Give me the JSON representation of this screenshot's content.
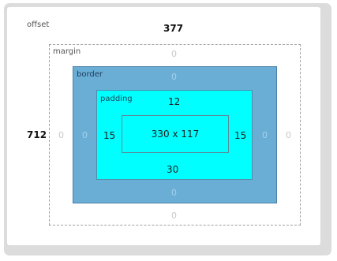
{
  "labels": {
    "offset": "offset",
    "margin": "margin",
    "border": "border",
    "padding": "padding"
  },
  "offset": {
    "top": "377",
    "left": "712"
  },
  "margin": {
    "top": "0",
    "right": "0",
    "bottom": "0",
    "left": "0"
  },
  "border": {
    "top": "0",
    "right": "0",
    "bottom": "0",
    "left": "0"
  },
  "padding": {
    "top": "12",
    "right": "15",
    "bottom": "30",
    "left": "15"
  },
  "content": {
    "size": "330 x 117"
  },
  "colors": {
    "border_fill": "#6aaed6",
    "padding_fill": "#00ffff",
    "panel": "#dcdcdc"
  }
}
